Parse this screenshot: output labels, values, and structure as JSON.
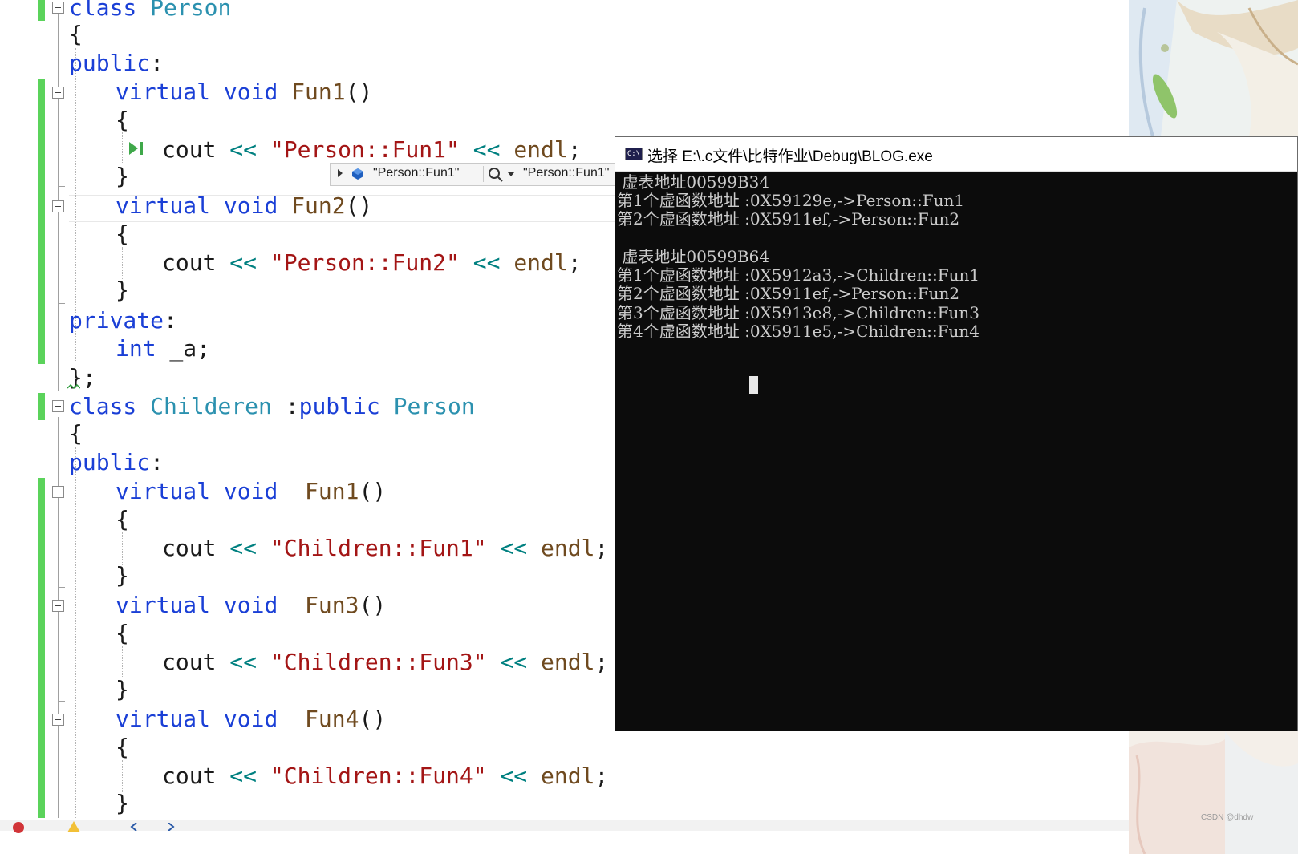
{
  "editor": {
    "lines": [
      [
        [
          "kw",
          "class"
        ],
        [
          "txt",
          " "
        ],
        [
          "ty",
          "Person"
        ]
      ],
      [
        [
          "punct",
          "{"
        ]
      ],
      [
        [
          "kw",
          "public"
        ],
        [
          "punct",
          ":"
        ]
      ],
      [
        [
          "kw",
          "virtual"
        ],
        [
          "txt",
          " "
        ],
        [
          "kw",
          "void"
        ],
        [
          "txt",
          " "
        ],
        [
          "fn",
          "Fun1"
        ],
        [
          "punct",
          "()"
        ]
      ],
      [
        [
          "punct",
          "{"
        ]
      ],
      [
        [
          "txt",
          "cout "
        ],
        [
          "op",
          "<<"
        ],
        [
          "txt",
          " "
        ],
        [
          "str",
          "\"Person::Fun1\""
        ],
        [
          "txt",
          " "
        ],
        [
          "op",
          "<<"
        ],
        [
          "txt",
          " "
        ],
        [
          "fn",
          "endl"
        ],
        [
          "punct",
          ";"
        ]
      ],
      [
        [
          "punct",
          "}"
        ]
      ],
      [
        [
          "kw",
          "virtual"
        ],
        [
          "txt",
          " "
        ],
        [
          "kw",
          "void"
        ],
        [
          "txt",
          " "
        ],
        [
          "fn",
          "Fun2"
        ],
        [
          "punct",
          "()"
        ]
      ],
      [
        [
          "punct",
          "{"
        ]
      ],
      [
        [
          "txt",
          "cout "
        ],
        [
          "op",
          "<<"
        ],
        [
          "txt",
          " "
        ],
        [
          "str",
          "\"Person::Fun2\""
        ],
        [
          "txt",
          " "
        ],
        [
          "op",
          "<<"
        ],
        [
          "txt",
          " "
        ],
        [
          "fn",
          "endl"
        ],
        [
          "punct",
          ";"
        ]
      ],
      [
        [
          "punct",
          "}"
        ]
      ],
      [
        [
          "kw",
          "private"
        ],
        [
          "punct",
          ":"
        ]
      ],
      [
        [
          "kw",
          "int"
        ],
        [
          "txt",
          " _a;"
        ]
      ],
      [
        [
          "punct",
          "};"
        ]
      ],
      [
        [
          "kw",
          "class"
        ],
        [
          "txt",
          " "
        ],
        [
          "ty",
          "Childeren"
        ],
        [
          "txt",
          " :"
        ],
        [
          "kw",
          "public"
        ],
        [
          "txt",
          " "
        ],
        [
          "ty",
          "Person"
        ]
      ],
      [
        [
          "punct",
          "{"
        ]
      ],
      [
        [
          "kw",
          "public"
        ],
        [
          "punct",
          ":"
        ]
      ],
      [
        [
          "kw",
          "virtual"
        ],
        [
          "txt",
          " "
        ],
        [
          "kw",
          "void"
        ],
        [
          "txt",
          "  "
        ],
        [
          "fn",
          "Fun1"
        ],
        [
          "punct",
          "()"
        ]
      ],
      [
        [
          "punct",
          "{"
        ]
      ],
      [
        [
          "txt",
          "cout "
        ],
        [
          "op",
          "<<"
        ],
        [
          "txt",
          " "
        ],
        [
          "str",
          "\"Children::Fun1\""
        ],
        [
          "txt",
          " "
        ],
        [
          "op",
          "<<"
        ],
        [
          "txt",
          " "
        ],
        [
          "fn",
          "endl"
        ],
        [
          "punct",
          ";"
        ]
      ],
      [
        [
          "punct",
          "}"
        ]
      ],
      [
        [
          "kw",
          "virtual"
        ],
        [
          "txt",
          " "
        ],
        [
          "kw",
          "void"
        ],
        [
          "txt",
          "  "
        ],
        [
          "fn",
          "Fun3"
        ],
        [
          "punct",
          "()"
        ]
      ],
      [
        [
          "punct",
          "{"
        ]
      ],
      [
        [
          "txt",
          "cout "
        ],
        [
          "op",
          "<<"
        ],
        [
          "txt",
          " "
        ],
        [
          "str",
          "\"Children::Fun3\""
        ],
        [
          "txt",
          " "
        ],
        [
          "op",
          "<<"
        ],
        [
          "txt",
          " "
        ],
        [
          "fn",
          "endl"
        ],
        [
          "punct",
          ";"
        ]
      ],
      [
        [
          "punct",
          "}"
        ]
      ],
      [
        [
          "kw",
          "virtual"
        ],
        [
          "txt",
          " "
        ],
        [
          "kw",
          "void"
        ],
        [
          "txt",
          "  "
        ],
        [
          "fn",
          "Fun4"
        ],
        [
          "punct",
          "()"
        ]
      ],
      [
        [
          "punct",
          "{"
        ]
      ],
      [
        [
          "txt",
          "cout "
        ],
        [
          "op",
          "<<"
        ],
        [
          "txt",
          " "
        ],
        [
          "str",
          "\"Children::Fun4\""
        ],
        [
          "txt",
          " "
        ],
        [
          "op",
          "<<"
        ],
        [
          "txt",
          " "
        ],
        [
          "fn",
          "endl"
        ],
        [
          "punct",
          ";"
        ]
      ],
      [
        [
          "punct",
          "}"
        ]
      ]
    ]
  },
  "datatip": {
    "name": "\"Person::Fun1\"",
    "value": "\"Person::Fun1\""
  },
  "console": {
    "title": "选择 E:\\.c文件\\比特作业\\Debug\\BLOG.exe",
    "icon_text": "C:\\",
    "lines": [
      " 虚表地址00599B34",
      "第1个虚函数地址 :0X59129e,->Person::Fun1",
      "第2个虚函数地址 :0X5911ef,->Person::Fun2",
      "",
      " 虚表地址00599B64",
      "第1个虚函数地址 :0X5912a3,->Children::Fun1",
      "第2个虚函数地址 :0X5911ef,->Person::Fun2",
      "第3个虚函数地址 :0X5913e8,->Children::Fun3",
      "第4个虚函数地址 :0X5911e5,->Children::Fun4"
    ]
  },
  "watermark": "CSDN @dhdw"
}
